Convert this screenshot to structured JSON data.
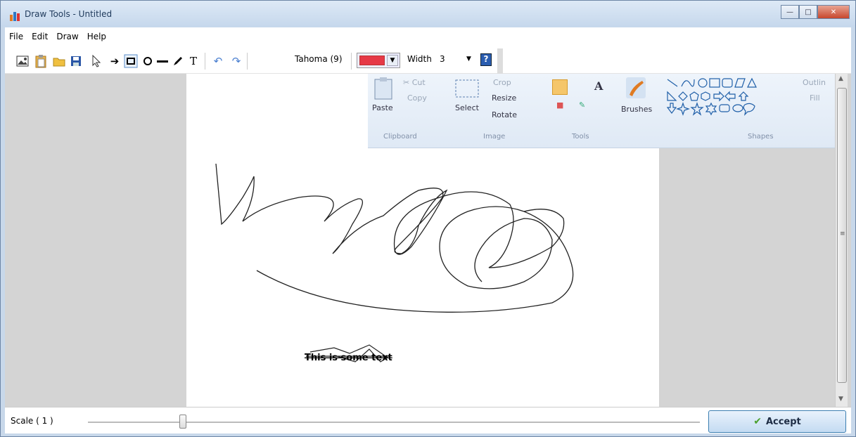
{
  "window": {
    "title": "Draw Tools - Untitled"
  },
  "menu": [
    "File",
    "Edit",
    "Draw",
    "Help"
  ],
  "toolbar": {
    "font": "Tahoma (9)",
    "width_label": "Width",
    "width_value": "3",
    "color": "#e63946"
  },
  "ribbon": {
    "clipboard": {
      "paste": "Paste",
      "cut": "Cut",
      "copy": "Copy",
      "group": "Clipboard"
    },
    "image": {
      "select": "Select",
      "crop": "Crop",
      "resize": "Resize",
      "rotate": "Rotate",
      "group": "Image"
    },
    "tools": {
      "group": "Tools"
    },
    "brushes": {
      "label": "Brushes"
    },
    "shapes": {
      "outline": "Outlin",
      "fill": "Fill",
      "group": "Shapes"
    }
  },
  "canvas": {
    "text": "This is some text"
  },
  "bottom": {
    "scale_label": "Scale (  1  )",
    "accept": "Accept",
    "scale_value": 1
  }
}
